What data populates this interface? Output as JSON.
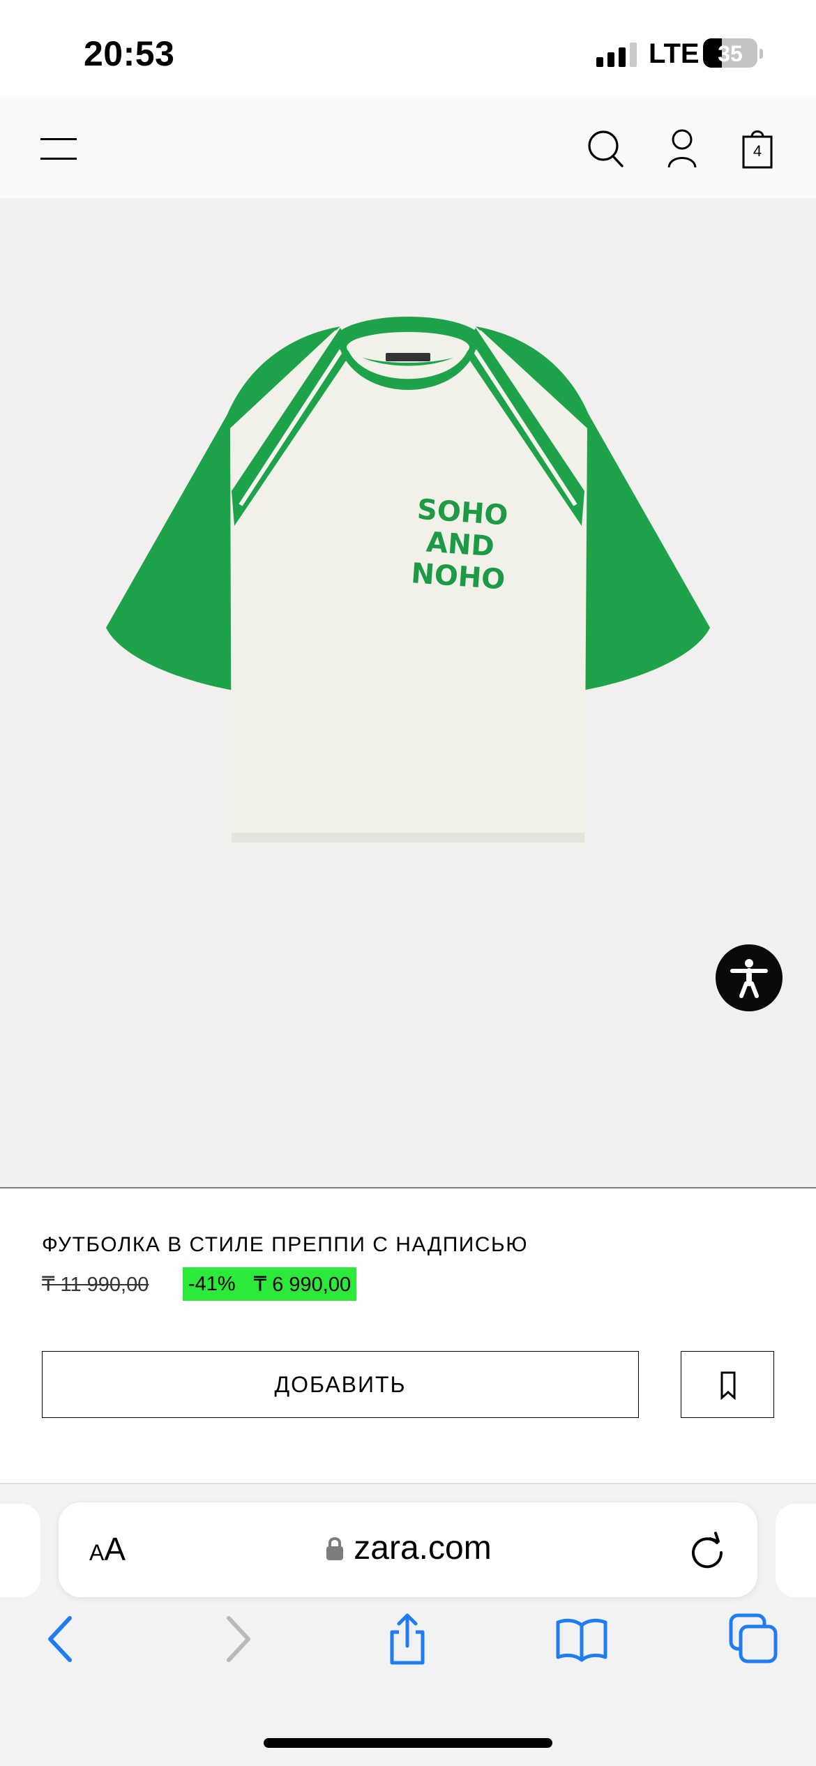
{
  "status_bar": {
    "time": "20:53",
    "network": "LTE",
    "battery": "35",
    "battery_level_percent": 35,
    "signal_bars_active": 3,
    "signal_bars_total": 4
  },
  "header": {
    "menu_icon": "hamburger-menu-icon",
    "search_icon": "search-icon",
    "account_icon": "user-icon",
    "bag_icon": "shopping-bag-icon",
    "bag_count": "4"
  },
  "product": {
    "image_alt": "green and white raglan t-shirt",
    "print_lines": [
      "SOHO",
      "AND",
      "NOHO"
    ],
    "title": "ФУТБОЛКА В СТИЛЕ ПРЕППИ С НАДПИСЬЮ",
    "old_price": "₸ 11 990,00",
    "discount": "-41%",
    "new_price": "₸ 6 990,00",
    "add_label": "ДОБАВИТЬ",
    "bookmark_icon": "bookmark-icon",
    "accessibility_icon": "accessibility-icon"
  },
  "colors": {
    "sale_badge": "#2dea3a",
    "shirt_green": "#1fa34a",
    "shirt_body": "#f2f1e9",
    "image_background": "#f1f0ee",
    "ios_blue": "#1f7cf2"
  },
  "browser": {
    "text_size_label": "AA",
    "url": "zara.com",
    "lock_icon": "lock-icon",
    "reload_icon": "reload-icon",
    "toolbar_icons": [
      "back-icon",
      "forward-icon",
      "share-icon",
      "bookmarks-icon",
      "tabs-icon"
    ]
  }
}
